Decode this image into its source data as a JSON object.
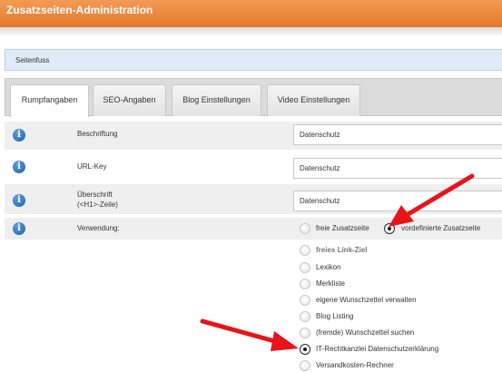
{
  "window": {
    "title": "Zusatzseiten-Administration"
  },
  "breadcrumb": "Seitenfuss",
  "tabs": [
    {
      "label": "Rumpfangaben",
      "active": true
    },
    {
      "label": "SEO-Angaben",
      "active": false
    },
    {
      "label": "Blog Einstellungen",
      "active": false
    },
    {
      "label": "Video Einstellungen",
      "active": false
    }
  ],
  "fields": {
    "beschriftung": {
      "label": "Beschriftung",
      "value": "Datenschutz"
    },
    "url_key": {
      "label": "URL-Key",
      "value": "Datenschutz"
    },
    "ueberschrift": {
      "label_line1": "Überschrift",
      "label_line2": "(<H1>-Zeile)",
      "value": "Datenschutz"
    }
  },
  "verwendung": {
    "label": "Verwendung:",
    "options": [
      {
        "label": "freie Zusatzseite",
        "checked": false
      },
      {
        "label": "vordefinierte Zusatzseite",
        "checked": true
      }
    ]
  },
  "page_types": [
    {
      "label": "freies Link-Ziel",
      "checked": false
    },
    {
      "label": "Lexikon",
      "checked": false
    },
    {
      "label": "Merkliste",
      "checked": false
    },
    {
      "label": "eigene Wunschzettel verwalten",
      "checked": false
    },
    {
      "label": "Blog Listing",
      "checked": false
    },
    {
      "label": "(fremde) Wunschzettel suchen",
      "checked": false
    },
    {
      "label": "IT-Rechtkanzlei Datenschutzerklärung",
      "checked": true
    },
    {
      "label": "Versandkosten-Rechner",
      "checked": false
    }
  ],
  "icons": {
    "info": "info-icon",
    "annotation": "red-arrow-icon"
  },
  "colors": {
    "titlebar": "#e8843a",
    "annotation_arrow": "#e8141b",
    "info_icon": "#2a6fbc"
  }
}
